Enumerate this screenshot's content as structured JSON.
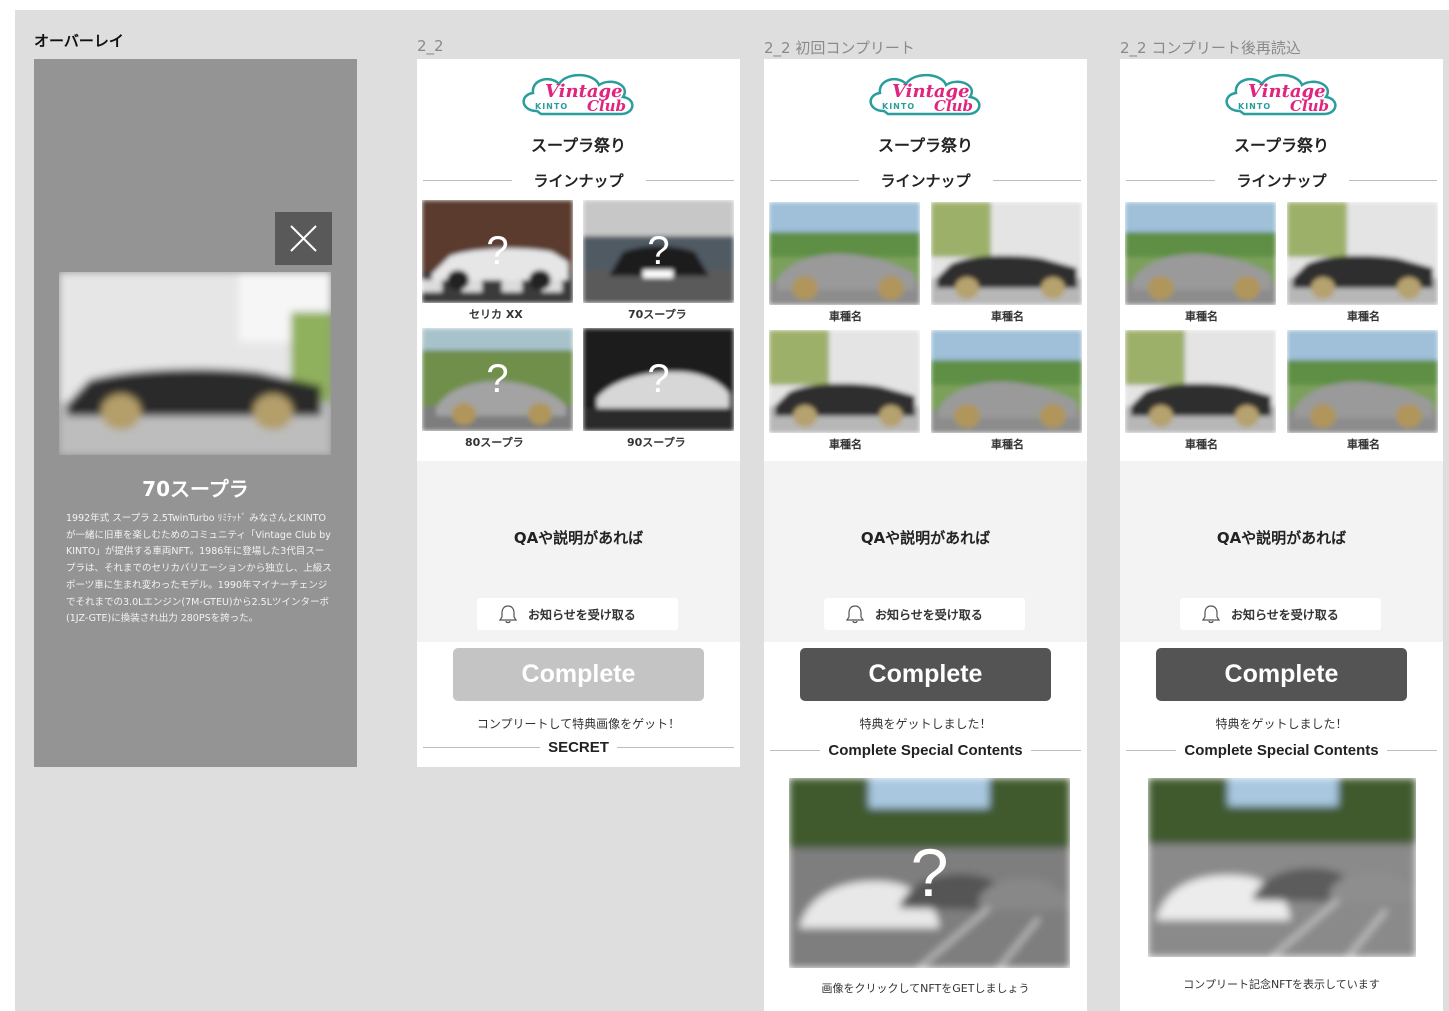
{
  "frames": {
    "overlay": {
      "label": "オーバーレイ"
    },
    "v1": {
      "label": "2_2"
    },
    "v2": {
      "label": "2_2 初回コンプリート"
    },
    "v3": {
      "label": "2_2 コンプリート後再読込"
    }
  },
  "logo": {
    "script": "Vintage",
    "script2": "Club",
    "brand": "KINTO"
  },
  "event_title": "スープラ祭り",
  "lineup_title": "ラインナップ",
  "overlay": {
    "car_title": "70スープラ",
    "description": "1992年式 スープラ 2.5TwinTurbo ﾘﾐﾃｯﾄﾞ みなさんとKINTOが一緒に旧車を楽しむためのコミュニティ「Vintage Club by KINTO」が提供する車両NFT。1986年に登場した3代目スープラは、それまでのセリカバリエーションから独立し、上級スポーツ車に生まれ変わったモデル。1990年マイナーチェンジでそれまでの3.0Lエンジン(7M-GTEU)から2.5Lツインターボ(1JZ-GTE)に換装され出力 280PSを誇った。"
  },
  "cars_secret": [
    {
      "name": "セリカ XX",
      "mark": "?"
    },
    {
      "name": "70スープラ",
      "mark": "?"
    },
    {
      "name": "80スープラ",
      "mark": "?"
    },
    {
      "name": "90スープラ",
      "mark": "?"
    }
  ],
  "cars_revealed": [
    {
      "name": "車種名"
    },
    {
      "name": "車種名"
    },
    {
      "name": "車種名"
    },
    {
      "name": "車種名"
    }
  ],
  "qa_text": "QAや説明があれば",
  "notify_label": "お知らせを受け取る",
  "complete_label": "Complete",
  "hint_before": "コンプリートして特典画像をゲット！",
  "hint_after": "特典をゲットしました！",
  "secret_title": "SECRET",
  "special_title": "Complete Special Contents",
  "special_mark": "?",
  "caption_first": "画像をクリックしてNFTをGETしましょう",
  "caption_reload": "コンプリート記念NFTを表示しています",
  "colors": {
    "logo_pink": "#e0257f",
    "logo_teal": "#2a9d9d",
    "button_active": "#545454",
    "button_disabled": "#c4c4c4"
  }
}
